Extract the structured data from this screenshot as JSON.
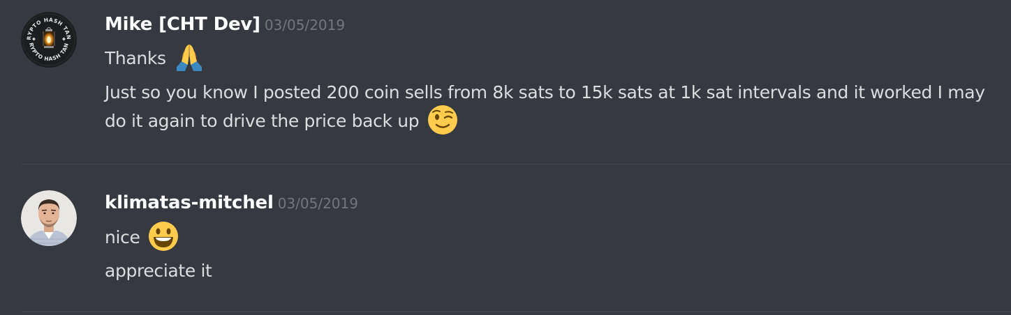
{
  "messages": [
    {
      "author": "Mike [CHT Dev]",
      "timestamp": "03/05/2019",
      "avatar": {
        "top_text": "CRYPTO HASH TANK",
        "bottom_text": "CRYPTO HASH TANK",
        "bg_color": "#1c1d1f"
      },
      "lines": [
        {
          "text": "Thanks",
          "emoji": "folded-hands-emoji"
        },
        {
          "text": "Just so you know I posted 200 coin sells from 8k sats to 15k sats at 1k sat intervals and it worked I may do it again to drive the price back up",
          "emoji": "winking-face-emoji"
        }
      ]
    },
    {
      "author": "klimatas-mitchel",
      "timestamp": "03/05/2019",
      "lines": [
        {
          "text": "nice",
          "emoji": "smiling-face-emoji"
        },
        {
          "text": "appreciate it"
        }
      ]
    }
  ],
  "colors": {
    "background": "#36393f",
    "username": "#ffffff",
    "timestamp": "#72767d",
    "message": "#dcddde",
    "divider": "#42454a"
  }
}
